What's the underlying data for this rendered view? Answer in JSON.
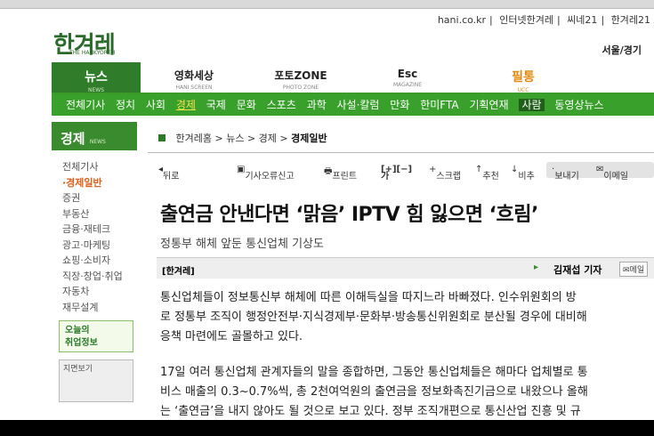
{
  "site": {
    "logo": "한겨레",
    "logo_sub": "THE HANKYOREH",
    "top_links": [
      "hani.co.kr",
      "인터넷한겨레",
      "씨네21",
      "한겨레21"
    ],
    "region": "서울/경기"
  },
  "sections": [
    {
      "label": "뉴스",
      "sub": "NEWS"
    },
    {
      "label": "영화세상",
      "sub": "HANI SCREEN"
    },
    {
      "label": "포토ZONE",
      "sub": "PHOTO ZONE"
    },
    {
      "label": "Esc",
      "sub": "MAGAZINE"
    },
    {
      "label": "필통",
      "sub": "UCC"
    }
  ],
  "menu": [
    "전체기사",
    "정치",
    "사회",
    "경제",
    "국제",
    "문화",
    "스포츠",
    "과학",
    "사설·칼럼",
    "만화",
    "한미FTA",
    "기획연재",
    "사람",
    "동영상뉴스"
  ],
  "menu_active": "경제",
  "sidebar": {
    "title": "경제",
    "title_sub": "NEWS",
    "items": [
      "전체기사",
      "·경제일반",
      "증권",
      "부동산",
      "금융·재테크",
      "광고·마케팅",
      "쇼핑·소비자",
      "직장·창업·취업",
      "자동차",
      "재무설계"
    ],
    "job_box": [
      "오늘의",
      "취업정보"
    ],
    "photo_box": "지면보기"
  },
  "breadcrumb": [
    "한겨레홈",
    "뉴스",
    "경제",
    "경제일반"
  ],
  "tools": {
    "back": "뒤로",
    "report": "기사오류신고",
    "print": "프린트",
    "font": "가",
    "scrap": "스크랩",
    "recommend": "추천",
    "oppose": "비추",
    "send": "보내기",
    "email": "이메일"
  },
  "article": {
    "headline": "출연금 안낸다면 ‘맑음’ IPTV 힘 잃으면 ‘흐림’",
    "subhead": "정통부 해체 앞둔 통신업체 기상도",
    "source": "[한겨레]",
    "reporter": "김재섭 기자",
    "mail": "메일",
    "paragraphs": [
      [
        "통신업체들이 정보통신부 해체에 따른 이해득실을 따지느라 바빠졌다. 인수위원회의 방",
        "로 정통부 조직이 행정안전부·지식경제부·문화부·방송통신위원회로 분산될 경우에 대비해",
        "응책 마련에도 골몰하고 있다."
      ],
      [
        "17일 여러 통신업체 관계자들의 말을 종합하면, 그동안 통신업체들은 해마다 업체별로 통",
        "비스 매출의 0.3~0.7%씩, 총 2천여억원의 출연금을 정보화촉진기금으로 내왔으나 올해",
        "는 ‘출연금’을 내지 않아도 될 것으로 보고 있다. 정부 조직개편으로 통신산업 진흥 및 규"
      ]
    ]
  }
}
